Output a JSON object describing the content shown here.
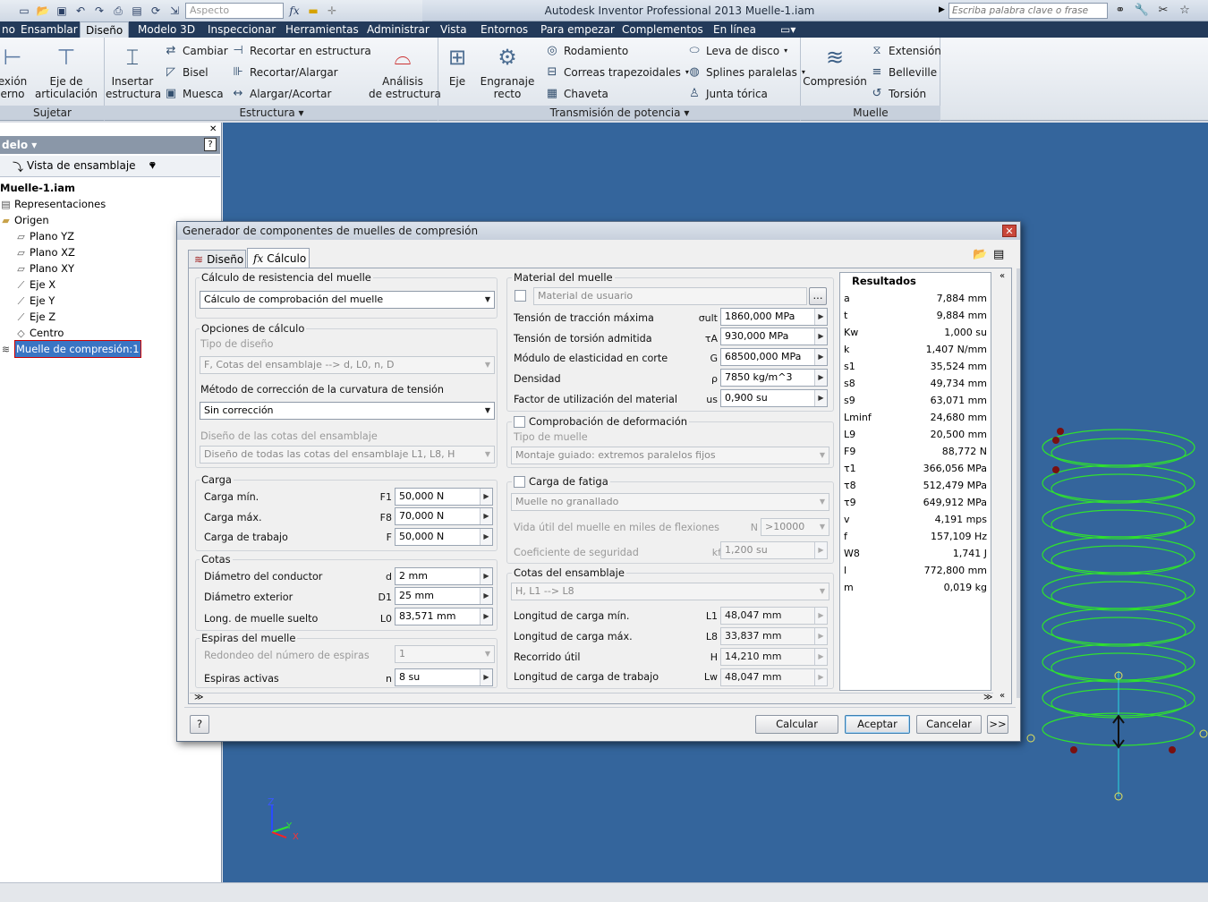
{
  "qat": {
    "style_placeholder": "Aspecto",
    "fx": "fx"
  },
  "app_title": "Autodesk Inventor Professional 2013    Muelle-1.iam",
  "search_placeholder": "Escriba palabra clave o frase",
  "menu_tabs": [
    "Ensamblar",
    "Diseño",
    "Modelo 3D",
    "Inspeccionar",
    "Herramientas",
    "Administrar",
    "Vista",
    "Entornos",
    "Para empezar",
    "Complementos",
    "En línea"
  ],
  "ribbon": {
    "sujetar": {
      "title": "Sujetar",
      "items": [
        "exión\nerno",
        "Eje de\narticulación"
      ]
    },
    "estructura": {
      "title": "Estructura",
      "big": "Insertar\nestructura",
      "small": [
        "Cambiar",
        "Bisel",
        "Muesca",
        "Recortar en estructura",
        "Recortar/Alargar",
        "Alargar/Acortar"
      ],
      "analysis": "Análisis\nde estructura"
    },
    "transmision": {
      "title": "Transmisión de potencia",
      "big": [
        "Eje",
        "Engranaje\nrecto"
      ],
      "small": [
        "Rodamiento",
        "Correas trapezoidales",
        "Chaveta",
        "Leva de disco",
        "Splines paralelas",
        "Junta tórica"
      ]
    },
    "muelle": {
      "title": "Muelle",
      "big": "Compresión",
      "small": [
        "Extensión",
        "Belleville",
        "Torsión"
      ]
    }
  },
  "browser": {
    "header": "delo",
    "view": "Vista de ensamblaje",
    "root": "Muelle-1.iam",
    "items": [
      "Representaciones",
      "Origen",
      "Plano YZ",
      "Plano XZ",
      "Plano XY",
      "Eje X",
      "Eje Y",
      "Eje Z",
      "Centro",
      "Muelle de compresión:1"
    ]
  },
  "axes": {
    "z": "Z",
    "y": "Y",
    "x": "X"
  },
  "dialog": {
    "title": "Generador de componentes de muelles de compresión",
    "tabs": [
      "Diseño",
      "Cálculo"
    ],
    "calc_type": {
      "legend": "Cálculo de resistencia del muelle",
      "value": "Cálculo de comprobación del muelle"
    },
    "options": {
      "legend": "Opciones de cálculo",
      "design_type_label": "Tipo de diseño",
      "design_type": "F, Cotas del ensamblaje --> d, L0, n, D",
      "correction_label": "Método de corrección de la curvatura de tensión",
      "correction": "Sin corrección",
      "assembly_label": "Diseño de las cotas del ensamblaje",
      "assembly": "Diseño de todas las cotas del ensamblaje L1, L8, H"
    },
    "load": {
      "legend": "Carga",
      "rows": [
        {
          "label": "Carga mín.",
          "sym": "F1",
          "value": "50,000 N"
        },
        {
          "label": "Carga máx.",
          "sym": "F8",
          "value": "70,000 N"
        },
        {
          "label": "Carga de trabajo",
          "sym": "F",
          "value": "50,000 N"
        }
      ]
    },
    "dims": {
      "legend": "Cotas",
      "rows": [
        {
          "label": "Diámetro del conductor",
          "sym": "d",
          "value": "2 mm"
        },
        {
          "label": "Diámetro exterior",
          "sym": "D1",
          "value": "25 mm"
        },
        {
          "label": "Long. de muelle suelto",
          "sym": "L0",
          "value": "83,571 mm"
        }
      ]
    },
    "coils": {
      "legend": "Espiras del muelle",
      "round_label": "Redondeo del número de espiras",
      "round_value": "1",
      "active_label": "Espiras activas",
      "active_sym": "n",
      "active_value": "8 su"
    },
    "material": {
      "legend": "Material del muelle",
      "user_label": "Material de usuario",
      "browse": "...",
      "rows": [
        {
          "label": "Tensión de tracción máxima",
          "sym": "σult",
          "value": "1860,000 MPa"
        },
        {
          "label": "Tensión de torsión admitida",
          "sym": "τA",
          "value": "930,000 MPa"
        },
        {
          "label": "Módulo de elasticidad en corte",
          "sym": "G",
          "value": "68500,000 MPa"
        },
        {
          "label": "Densidad",
          "sym": "ρ",
          "value": "7850 kg/m^3"
        },
        {
          "label": "Factor de utilización del material",
          "sym": "us",
          "value": "0,900 su"
        }
      ]
    },
    "deform": {
      "label": "Comprobación de deformación",
      "type_label": "Tipo de muelle",
      "type_value": "Montaje guiado: extremos paralelos fijos"
    },
    "fatigue": {
      "label": "Carga de fatiga",
      "type_value": "Muelle no granallado",
      "life_label": "Vida útil del muelle en miles de flexiones",
      "life_sym": "N",
      "life_value": ">10000",
      "safety_label": "Coeficiente de seguridad",
      "safety_sym": "kf",
      "safety_value": "1,200 su"
    },
    "assembly_dims": {
      "legend": "Cotas del ensamblaje",
      "combo": "H, L1 --> L8",
      "rows": [
        {
          "label": "Longitud de carga mín.",
          "sym": "L1",
          "value": "48,047 mm"
        },
        {
          "label": "Longitud de carga máx.",
          "sym": "L8",
          "value": "33,837 mm"
        },
        {
          "label": "Recorrido útil",
          "sym": "H",
          "value": "14,210 mm"
        },
        {
          "label": "Longitud de carga de trabajo",
          "sym": "Lw",
          "value": "48,047 mm"
        }
      ]
    },
    "results": {
      "title": "Resultados",
      "rows": [
        {
          "n": "a",
          "v": "7,884 mm"
        },
        {
          "n": "t",
          "v": "9,884 mm"
        },
        {
          "n": "Kw",
          "v": "1,000 su"
        },
        {
          "n": "k",
          "v": "1,407 N/mm"
        },
        {
          "n": "s1",
          "v": "35,524 mm"
        },
        {
          "n": "s8",
          "v": "49,734 mm"
        },
        {
          "n": "s9",
          "v": "63,071 mm"
        },
        {
          "n": "Lminf",
          "v": "24,680 mm"
        },
        {
          "n": "L9",
          "v": "20,500 mm"
        },
        {
          "n": "F9",
          "v": "88,772 N"
        },
        {
          "n": "τ1",
          "v": "366,056 MPa"
        },
        {
          "n": "τ8",
          "v": "512,479 MPa"
        },
        {
          "n": "τ9",
          "v": "649,912 MPa"
        },
        {
          "n": "v",
          "v": "4,191 mps"
        },
        {
          "n": "f",
          "v": "157,109 Hz"
        },
        {
          "n": "W8",
          "v": "1,741 J"
        },
        {
          "n": "l",
          "v": "772,800 mm"
        },
        {
          "n": "m",
          "v": "0,019 kg"
        }
      ]
    },
    "buttons": {
      "help": "?",
      "calc": "Calcular",
      "ok": "Aceptar",
      "cancel": "Cancelar",
      "more": ">>"
    }
  }
}
